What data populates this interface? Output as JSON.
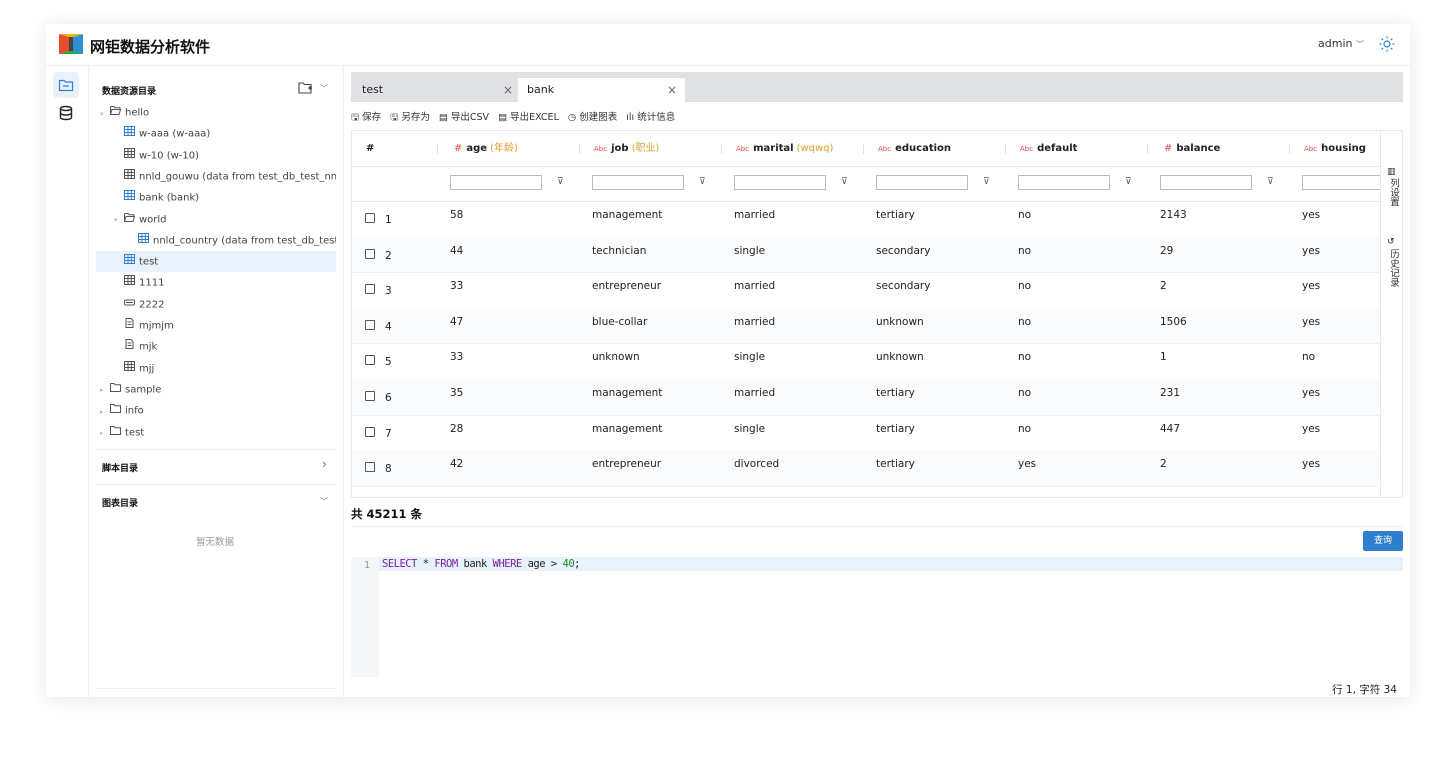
{
  "app": {
    "title": "网钜数据分析软件",
    "user": "admin"
  },
  "sidebar": {
    "data_section_title": "数据资源目录",
    "tree": [
      {
        "label": "hello",
        "icon": "folder-open-icon",
        "expand": "▾"
      },
      {
        "label": "w-aaa (w-aaa)",
        "icon": "table-icon"
      },
      {
        "label": "w-10 (w-10)",
        "icon": "table-icon"
      },
      {
        "label": "nnld_gouwu (data from test_db_test_nnld_gouwu)",
        "icon": "table-icon"
      },
      {
        "label": "bank (bank)",
        "icon": "table-icon"
      },
      {
        "label": "world",
        "icon": "folder-open-icon",
        "expand": "▾"
      },
      {
        "label": "nnld_country (data from test_db_test_nnld_country)",
        "icon": "table-icon"
      },
      {
        "label": "test",
        "icon": "table-icon"
      },
      {
        "label": "1111",
        "icon": "table-icon"
      },
      {
        "label": "2222",
        "icon": "database-icon"
      },
      {
        "label": "mjmjm",
        "icon": "file-icon"
      },
      {
        "label": "mjk",
        "icon": "file-icon"
      },
      {
        "label": "mjj",
        "icon": "table-icon"
      },
      {
        "label": "sample",
        "icon": "folder-icon",
        "expand": "▸"
      },
      {
        "label": "info",
        "icon": "folder-icon",
        "expand": "▸"
      },
      {
        "label": "test",
        "icon": "folder-icon",
        "expand": "▸"
      }
    ],
    "script_section_title": "脚本目录",
    "chart_section_title": "图表目录",
    "empty_text": "暂无数据"
  },
  "tabs": [
    {
      "label": "test"
    },
    {
      "label": "bank"
    }
  ],
  "toolbar": {
    "save": "保存",
    "save_as": "另存为",
    "export_csv": "导出CSV",
    "export_excel": "导出EXCEL",
    "create_chart": "创建图表",
    "stats": "统计信息"
  },
  "table": {
    "index_header": "#",
    "columns": [
      {
        "type": "#",
        "name": "age",
        "alias": "(年龄)"
      },
      {
        "type": "Abc",
        "name": "job",
        "alias": "(职业)"
      },
      {
        "type": "Abc",
        "name": "marital",
        "alias": "(wqwq)"
      },
      {
        "type": "Abc",
        "name": "education",
        "alias": ""
      },
      {
        "type": "Abc",
        "name": "default",
        "alias": ""
      },
      {
        "type": "#",
        "name": "balance",
        "alias": ""
      },
      {
        "type": "Abc",
        "name": "housing",
        "alias": ""
      }
    ],
    "rows": [
      [
        "1",
        "58",
        "management",
        "married",
        "tertiary",
        "no",
        "2143",
        "yes"
      ],
      [
        "2",
        "44",
        "technician",
        "single",
        "secondary",
        "no",
        "29",
        "yes"
      ],
      [
        "3",
        "33",
        "entrepreneur",
        "married",
        "secondary",
        "no",
        "2",
        "yes"
      ],
      [
        "4",
        "47",
        "blue-collar",
        "married",
        "unknown",
        "no",
        "1506",
        "yes"
      ],
      [
        "5",
        "33",
        "unknown",
        "single",
        "unknown",
        "no",
        "1",
        "no"
      ],
      [
        "6",
        "35",
        "management",
        "married",
        "tertiary",
        "no",
        "231",
        "yes"
      ],
      [
        "7",
        "28",
        "management",
        "single",
        "tertiary",
        "no",
        "447",
        "yes"
      ],
      [
        "8",
        "42",
        "entrepreneur",
        "divorced",
        "tertiary",
        "yes",
        "2",
        "yes"
      ]
    ],
    "right_panel": {
      "columns_settings": "列设置",
      "history": "历史记录"
    },
    "total": "共 45211 条"
  },
  "editor": {
    "query_button": "查询",
    "line_number": "1",
    "sql_tokens": [
      {
        "t": "SELECT",
        "c": "kw"
      },
      {
        "t": " * ",
        "c": ""
      },
      {
        "t": "FROM",
        "c": "kw"
      },
      {
        "t": " bank ",
        "c": ""
      },
      {
        "t": "WHERE",
        "c": "kw"
      },
      {
        "t": " age > ",
        "c": ""
      },
      {
        "t": "40",
        "c": "num"
      },
      {
        "t": ";",
        "c": ""
      }
    ],
    "status": "行 1,  字符 34"
  },
  "colors": {
    "accent": "#2f7fce",
    "alias": "#e0a030",
    "type_abc": "#e84a4a",
    "type_num": "#e84a4a",
    "selected_row": "#e8f1fc"
  }
}
